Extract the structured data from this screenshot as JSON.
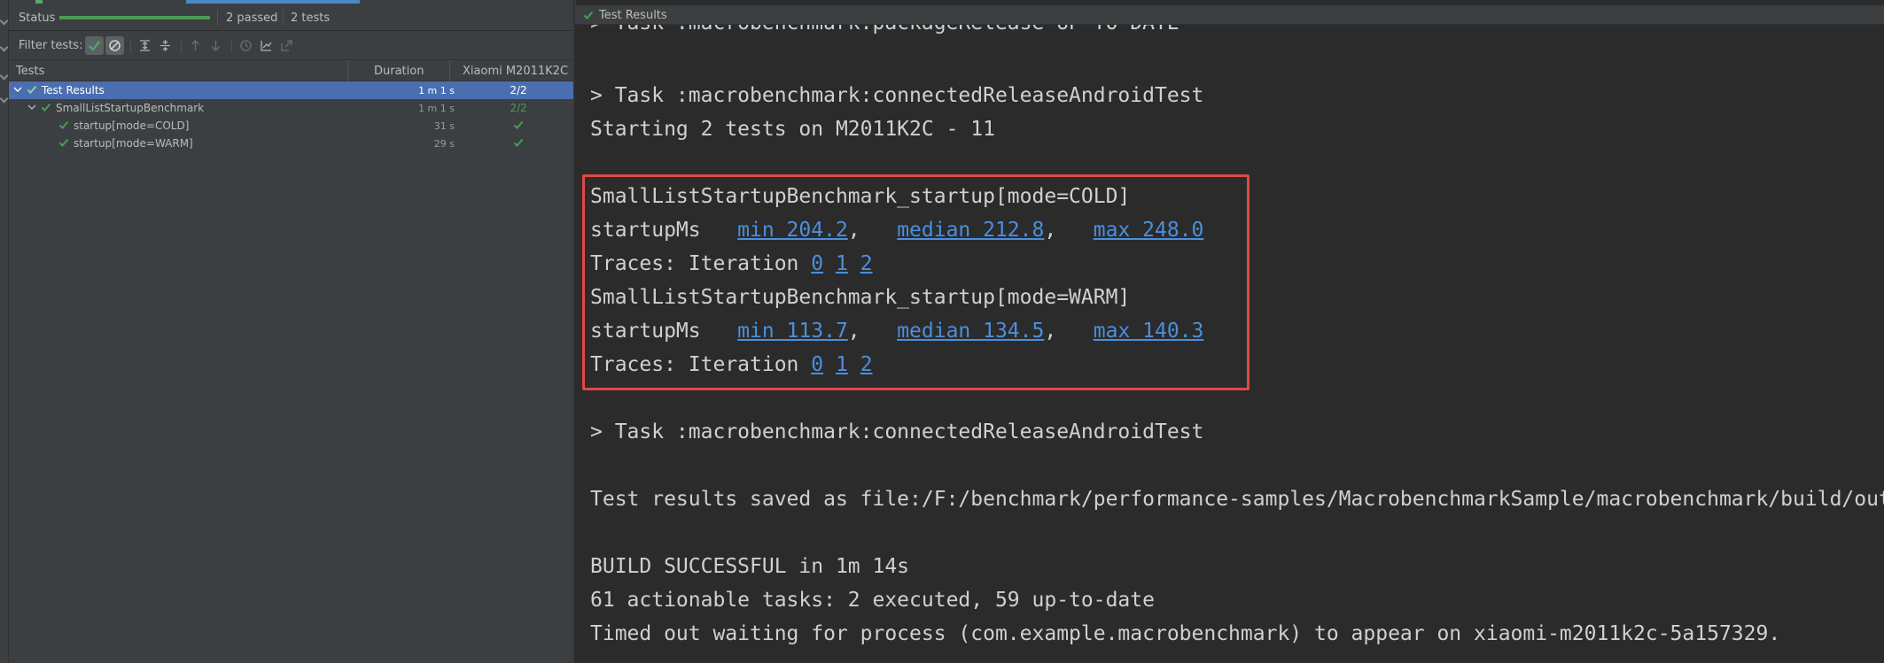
{
  "colors": {
    "accent_green": "#499c54",
    "selection": "#4b6eaf",
    "link": "#4b8fde",
    "highlight_box": "#e04848"
  },
  "status": {
    "label": "Status",
    "progress": 1.0,
    "passed": "2 passed",
    "count": "2 tests"
  },
  "filter": {
    "label": "Filter tests:",
    "buttons": [
      "show-passed-icon",
      "show-ignored-icon",
      "expand-all-icon",
      "collapse-all-icon",
      "previous-failed-icon",
      "next-failed-icon",
      "history-icon",
      "import-tests-icon",
      "export-tests-icon"
    ]
  },
  "tree": {
    "columns": {
      "tests": "Tests",
      "duration": "Duration",
      "device": "Xiaomi M2011K2C"
    },
    "rows": [
      {
        "name": "Test Results",
        "duration": "1 m 1 s",
        "device": "2/2"
      },
      {
        "name": "SmallListStartupBenchmark",
        "duration": "1 m 1 s",
        "device": "2/2"
      },
      {
        "name": "startup[mode=COLD]",
        "duration": "31 s",
        "device": "passed"
      },
      {
        "name": "startup[mode=WARM]",
        "duration": "29 s",
        "device": "passed"
      }
    ]
  },
  "console": {
    "title": "Test Results",
    "lines": {
      "l0": "> Task :macrobenchmark:packageRelease UP-TO-DATE",
      "l1": "> Task :macrobenchmark:connectedReleaseAndroidTest",
      "l2": "Starting 2 tests on M2011K2C - 11",
      "l3": "SmallListStartupBenchmark_startup[mode=COLD]",
      "l4_prefix": "startupMs   ",
      "l4_min": "min 204.2",
      "l4_sep1": ",   ",
      "l4_median": "median 212.8",
      "l4_sep2": ",   ",
      "l4_max": "max 248.0",
      "l5_prefix": "Traces: Iteration ",
      "l6": "SmallListStartupBenchmark_startup[mode=WARM]",
      "l7_prefix": "startupMs   ",
      "l7_min": "min 113.7",
      "l7_sep1": ",   ",
      "l7_median": "median 134.5",
      "l7_sep2": ",   ",
      "l7_max": "max 140.3",
      "l8_prefix": "Traces: Iteration ",
      "l9": "> Task :macrobenchmark:connectedReleaseAndroidTest",
      "l10": "Test results saved as file:/F:/benchmark/performance-samples/MacrobenchmarkSample/macrobenchmark/build/outputs",
      "l11": "BUILD SUCCESSFUL in 1m 14s",
      "l12": "61 actionable tasks: 2 executed, 59 up-to-date",
      "l13": "Timed out waiting for process (com.example.macrobenchmark) to appear on xiaomi-m2011k2c-5a157329."
    },
    "iterations": [
      "0",
      "1",
      "2"
    ]
  }
}
